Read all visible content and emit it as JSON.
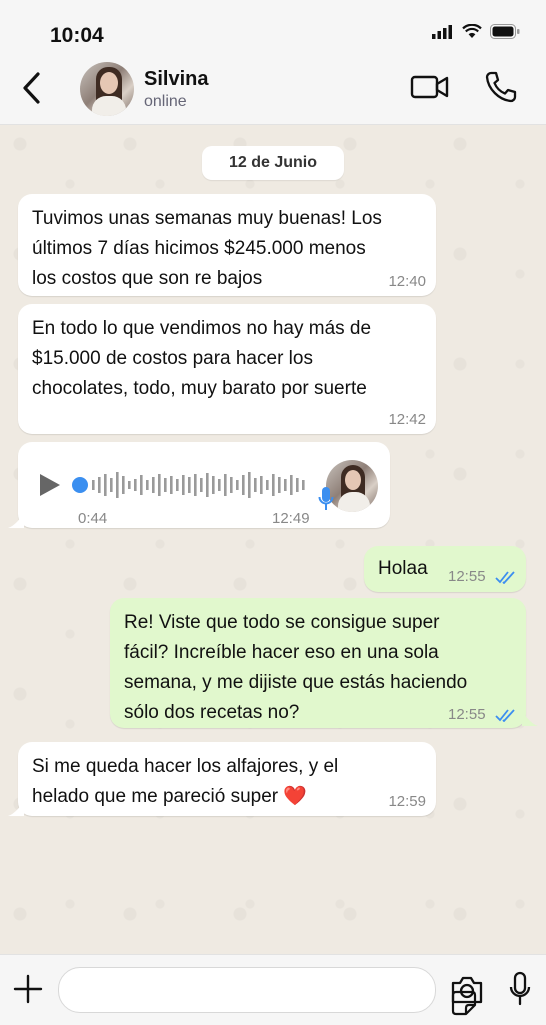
{
  "status_bar": {
    "time": "10:04"
  },
  "header": {
    "name": "Silvina",
    "status": "online"
  },
  "date_label": "12 de Junio",
  "messages": [
    {
      "text_lines": [
        "Tuvimos unas semanas muy buenas! Los",
        "últimos 7 días hicimos $245.000 menos",
        "los costos que son re bajos"
      ],
      "time": "12:40"
    },
    {
      "text_lines": [
        "En todo lo que vendimos no hay más de",
        "$15.000 de costos para hacer los",
        "chocolates, todo, muy barato por suerte"
      ],
      "time": "12:42"
    },
    {
      "voice": {
        "duration": "0:44",
        "time": "12:49",
        "progress": 0.0
      }
    },
    {
      "text": "Holaa",
      "time": "12:55",
      "read": true
    },
    {
      "text_lines": [
        "Re! Viste que todo se consigue super",
        "fácil? Increíble hacer eso en una sola",
        "semana, y me dijiste que estás haciendo",
        "sólo dos recetas no?"
      ],
      "time": "12:55",
      "read": true
    },
    {
      "text_lines": [
        "Si me queda hacer los alfajores, y el",
        "helado que me pareció super ❤️"
      ],
      "time": "12:59"
    }
  ],
  "colors": {
    "accent_blue": "#3b82f6",
    "outgoing_bubble": "#e1f8cd",
    "incoming_bubble": "#ffffff",
    "read_tick": "#3c8ef0"
  },
  "icons": [
    "back-arrow-icon",
    "video-call-icon",
    "phone-icon",
    "play-icon",
    "mic-icon",
    "plus-icon",
    "sticker-icon",
    "camera-icon",
    "double-check-icon"
  ]
}
